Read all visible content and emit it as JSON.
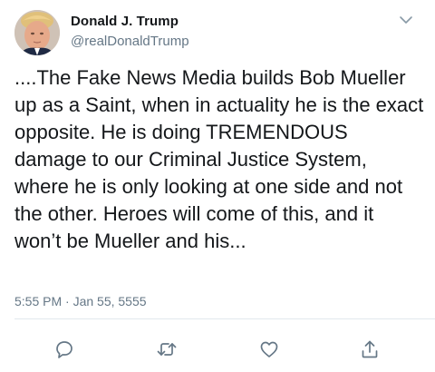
{
  "tweet": {
    "display_name": "Donald J. Trump",
    "handle": "@realDonaldTrump",
    "text": "....The Fake News Media builds Bob Mueller up as a Saint, when in actuality he is the exact opposite. He is doing TREMENDOUS damage to our Criminal Justice System, where he is only looking at one side and not the other. Heroes will come of this, and it won’t be Mueller and his...",
    "timestamp": "5:55 PM · Jan 55, 5555"
  },
  "icons": {
    "more": "chevron-down-icon",
    "reply": "reply-icon",
    "retweet": "retweet-icon",
    "like": "heart-icon",
    "share": "share-icon"
  },
  "colors": {
    "text": "#14171a",
    "secondary": "#657786",
    "icon": "#657786",
    "divider": "#e1e8ed"
  }
}
